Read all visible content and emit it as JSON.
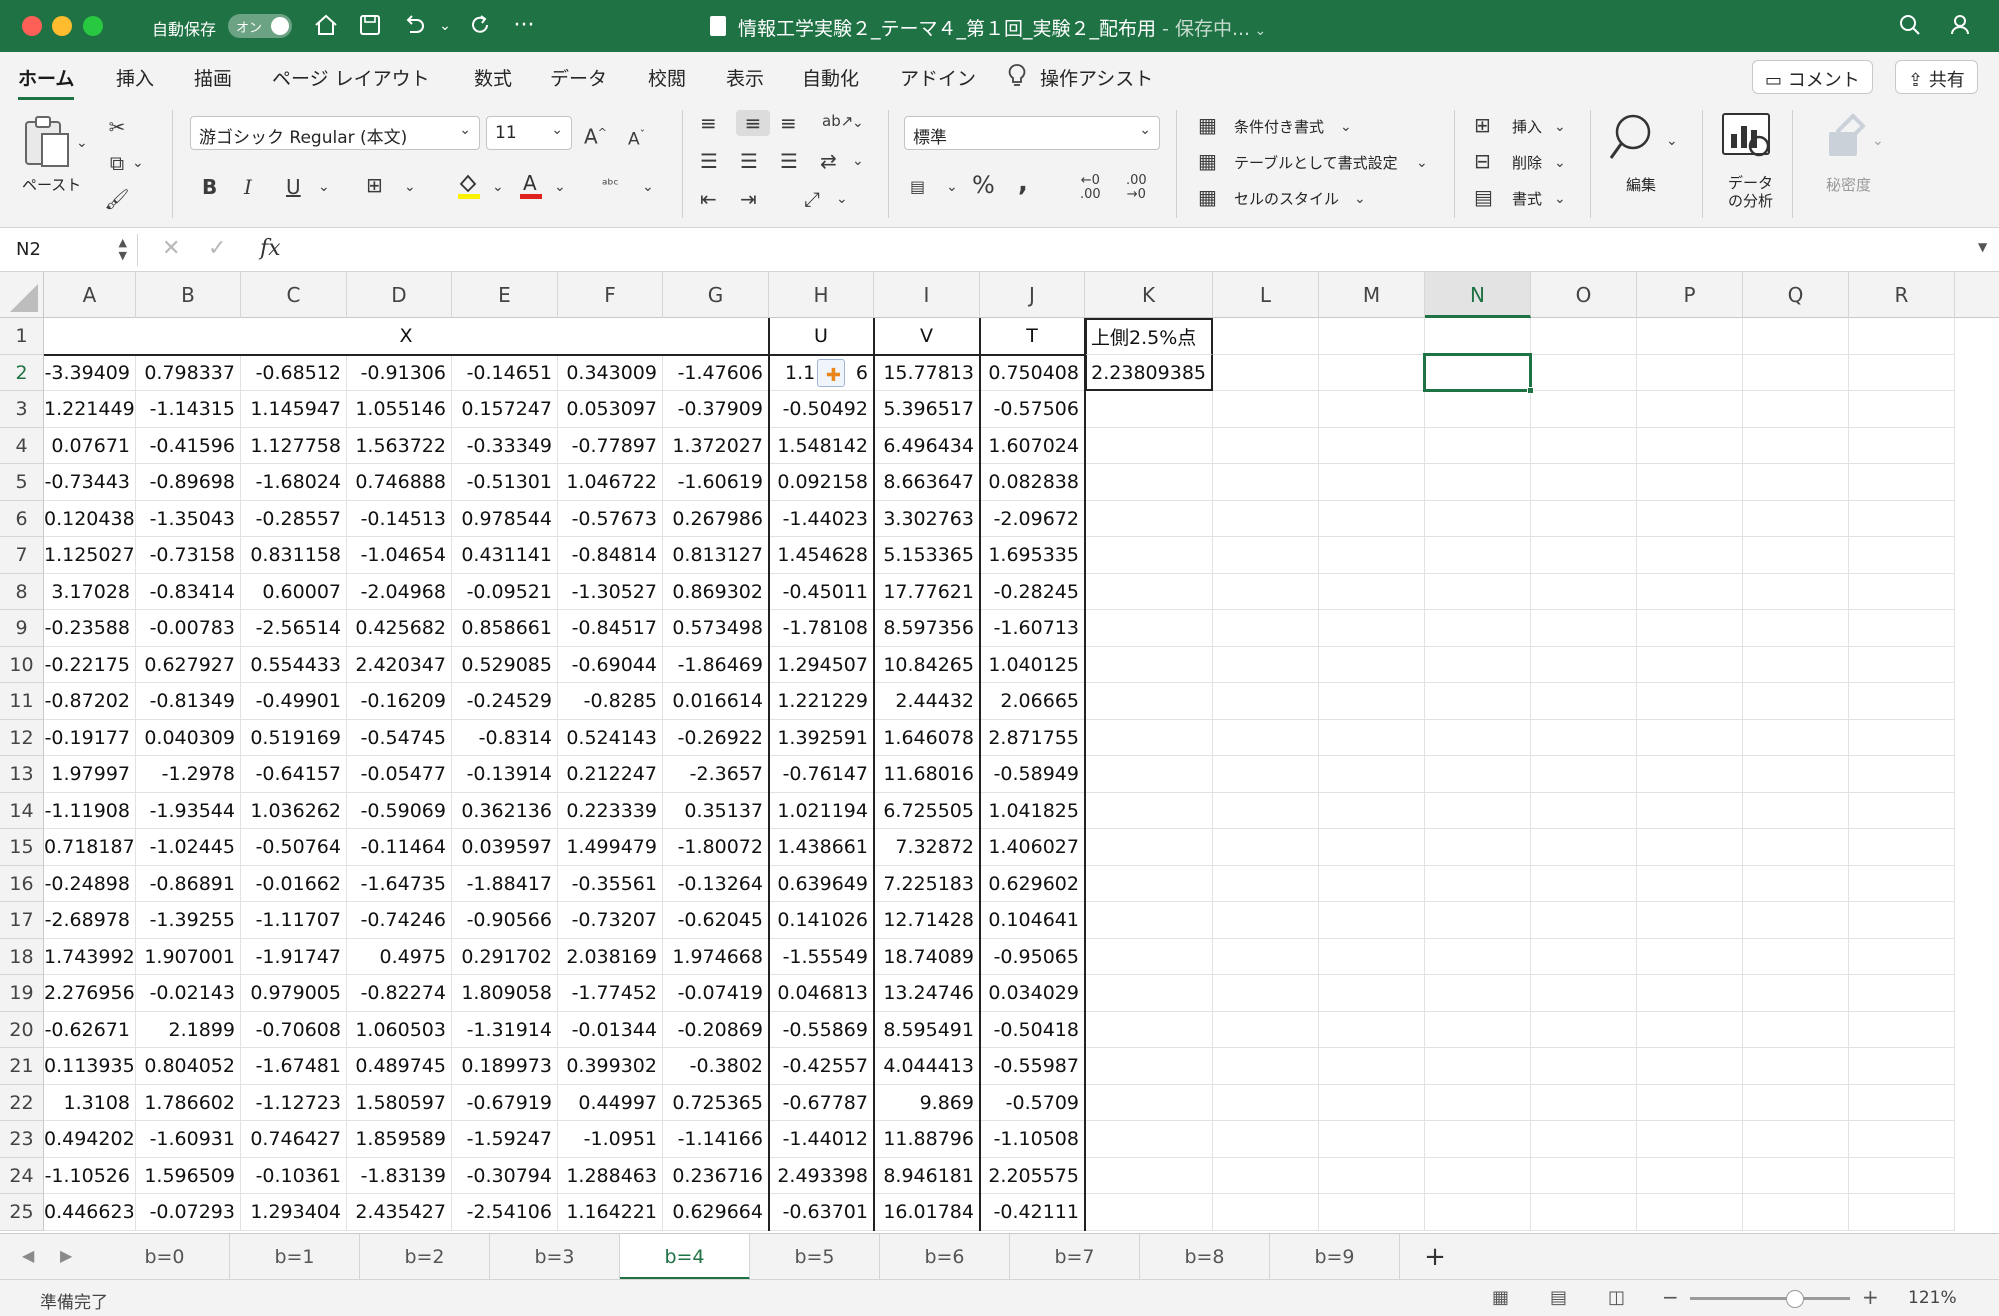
{
  "titlebar": {
    "autosave_label": "自動保存",
    "autosave_state": "オン",
    "doc_name": "情報工学実験２_テーマ４_第１回_実験２_配布用",
    "doc_status": " - 保存中..."
  },
  "ribbon_tabs": [
    "ホーム",
    "挿入",
    "描画",
    "ページ レイアウト",
    "数式",
    "データ",
    "校閲",
    "表示",
    "自動化",
    "アドイン",
    "操作アシスト"
  ],
  "active_tab": "ホーム",
  "comment_label": "コメント",
  "share_label": "共有",
  "ribbon": {
    "paste_label": "ペースト",
    "font_name": "游ゴシック Regular (本文)",
    "font_size": "11",
    "number_format": "標準",
    "bold": "B",
    "italic": "I",
    "underline": "U",
    "cond_format": "条件付き書式",
    "format_as_table": "テーブルとして書式設定",
    "cell_styles": "セルのスタイル",
    "insert": "挿入",
    "delete": "削除",
    "format": "書式",
    "edit": "編集",
    "data_analysis_line1": "データ",
    "data_analysis_line2": "の分析",
    "sensitivity": "秘密度"
  },
  "formula_bar": {
    "name_box": "N2",
    "fx": "fx",
    "formula": ""
  },
  "grid": {
    "columns": [
      "A",
      "B",
      "C",
      "D",
      "E",
      "F",
      "G",
      "H",
      "I",
      "J",
      "K",
      "L",
      "M",
      "N",
      "O",
      "P",
      "Q",
      "R"
    ],
    "selected_column": "N",
    "selected_row": 2,
    "row1": {
      "X": "X",
      "U": "U",
      "V": "V",
      "T": "T",
      "K1": "上側2.5%点"
    },
    "K2": "2.23809385",
    "rows": [
      [
        "-3.39409",
        "0.798337",
        "-0.68512",
        "-0.91306",
        "-0.14651",
        "0.343009",
        "-1.47606",
        "1.1",
        "15.77813",
        "0.750408"
      ],
      [
        "1.221449",
        "-1.14315",
        "1.145947",
        "1.055146",
        "0.157247",
        "0.053097",
        "-0.37909",
        "-0.50492",
        "5.396517",
        "-0.57506"
      ],
      [
        "0.07671",
        "-0.41596",
        "1.127758",
        "1.563722",
        "-0.33349",
        "-0.77897",
        "1.372027",
        "1.548142",
        "6.496434",
        "1.607024"
      ],
      [
        "-0.73443",
        "-0.89698",
        "-1.68024",
        "0.746888",
        "-0.51301",
        "1.046722",
        "-1.60619",
        "0.092158",
        "8.663647",
        "0.082838"
      ],
      [
        "0.120438",
        "-1.35043",
        "-0.28557",
        "-0.14513",
        "0.978544",
        "-0.57673",
        "0.267986",
        "-1.44023",
        "3.302763",
        "-2.09672"
      ],
      [
        "1.125027",
        "-0.73158",
        "0.831158",
        "-1.04654",
        "0.431141",
        "-0.84814",
        "0.813127",
        "1.454628",
        "5.153365",
        "1.695335"
      ],
      [
        "3.17028",
        "-0.83414",
        "0.60007",
        "-2.04968",
        "-0.09521",
        "-1.30527",
        "0.869302",
        "-0.45011",
        "17.77621",
        "-0.28245"
      ],
      [
        "-0.23588",
        "-0.00783",
        "-2.56514",
        "0.425682",
        "0.858661",
        "-0.84517",
        "0.573498",
        "-1.78108",
        "8.597356",
        "-1.60713"
      ],
      [
        "-0.22175",
        "0.627927",
        "0.554433",
        "2.420347",
        "0.529085",
        "-0.69044",
        "-1.86469",
        "1.294507",
        "10.84265",
        "1.040125"
      ],
      [
        "-0.87202",
        "-0.81349",
        "-0.49901",
        "-0.16209",
        "-0.24529",
        "-0.8285",
        "0.016614",
        "1.221229",
        "2.44432",
        "2.06665"
      ],
      [
        "-0.19177",
        "0.040309",
        "0.519169",
        "-0.54745",
        "-0.8314",
        "0.524143",
        "-0.26922",
        "1.392591",
        "1.646078",
        "2.871755"
      ],
      [
        "1.97997",
        "-1.2978",
        "-0.64157",
        "-0.05477",
        "-0.13914",
        "0.212247",
        "-2.3657",
        "-0.76147",
        "11.68016",
        "-0.58949"
      ],
      [
        "-1.11908",
        "-1.93544",
        "1.036262",
        "-0.59069",
        "0.362136",
        "0.223339",
        "0.35137",
        "1.021194",
        "6.725505",
        "1.041825"
      ],
      [
        "0.718187",
        "-1.02445",
        "-0.50764",
        "-0.11464",
        "0.039597",
        "1.499479",
        "-1.80072",
        "1.438661",
        "7.32872",
        "1.406027"
      ],
      [
        "-0.24898",
        "-0.86891",
        "-0.01662",
        "-1.64735",
        "-1.88417",
        "-0.35561",
        "-0.13264",
        "0.639649",
        "7.225183",
        "0.629602"
      ],
      [
        "-2.68978",
        "-1.39255",
        "-1.11707",
        "-0.74246",
        "-0.90566",
        "-0.73207",
        "-0.62045",
        "0.141026",
        "12.71428",
        "0.104641"
      ],
      [
        "1.743992",
        "1.907001",
        "-1.91747",
        "0.4975",
        "0.291702",
        "2.038169",
        "1.974668",
        "-1.55549",
        "18.74089",
        "-0.95065"
      ],
      [
        "2.276956",
        "-0.02143",
        "0.979005",
        "-0.82274",
        "1.809058",
        "-1.77452",
        "-0.07419",
        "0.046813",
        "13.24746",
        "0.034029"
      ],
      [
        "-0.62671",
        "2.1899",
        "-0.70608",
        "1.060503",
        "-1.31914",
        "-0.01344",
        "-0.20869",
        "-0.55869",
        "8.595491",
        "-0.50418"
      ],
      [
        "0.113935",
        "0.804052",
        "-1.67481",
        "0.489745",
        "0.189973",
        "0.399302",
        "-0.3802",
        "-0.42557",
        "4.044413",
        "-0.55987"
      ],
      [
        "1.3108",
        "1.786602",
        "-1.12723",
        "1.580597",
        "-0.67919",
        "0.44997",
        "0.725365",
        "-0.67787",
        "9.869",
        "-0.5709"
      ],
      [
        "0.494202",
        "-1.60931",
        "0.746427",
        "1.859589",
        "-1.59247",
        "-1.0951",
        "-1.14166",
        "-1.44012",
        "11.88796",
        "-1.10508"
      ],
      [
        "-1.10526",
        "1.596509",
        "-0.10361",
        "-1.83139",
        "-0.30794",
        "1.288463",
        "0.236716",
        "2.493398",
        "8.946181",
        "2.205575"
      ],
      [
        "0.446623",
        "-0.07293",
        "1.293404",
        "2.435427",
        "-2.54106",
        "1.164221",
        "0.629664",
        "-0.63701",
        "16.01784",
        "-0.42111"
      ]
    ],
    "h2_tail": "6"
  },
  "sheet_tabs": [
    "b=0",
    "b=1",
    "b=2",
    "b=3",
    "b=4",
    "b=5",
    "b=6",
    "b=7",
    "b=8",
    "b=9"
  ],
  "active_sheet": "b=4",
  "add_sheet": "+",
  "status": {
    "text": "準備完了",
    "zoom": "121%",
    "zoom_minus": "−",
    "zoom_plus": "+"
  },
  "colors": {
    "brand": "#1f7244",
    "title_bar": "#1f7244"
  }
}
